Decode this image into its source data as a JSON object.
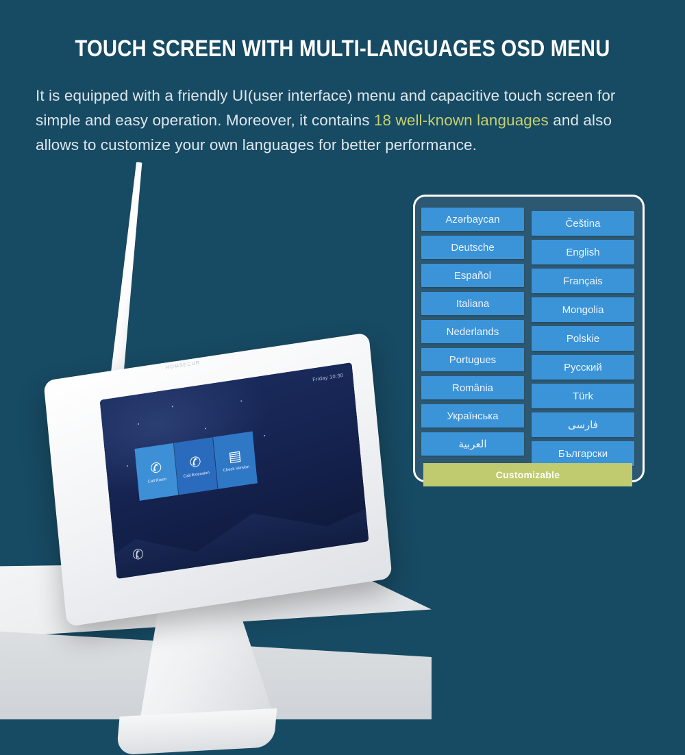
{
  "header": {
    "title": "TOUCH SCREEN WITH MULTI-LANGUAGES OSD MENU",
    "body_part1": "It is equipped with a friendly UI(user interface) menu and capacitive touch screen for simple and easy operation. Moreover, it contains ",
    "body_highlight": "18 well-known languages",
    "body_part2": " and also allows to customize your own languages for better performance."
  },
  "colors": {
    "background": "#174a63",
    "panel": "#2d5871",
    "button": "#3b93d8",
    "accent": "#bfcb6e",
    "frame": "#ffffff"
  },
  "languages": {
    "left_column": [
      "Azərbaycan",
      "Deutsche",
      "Español",
      "Italiana",
      "Nederlands",
      "Portugues",
      "România",
      "Українська",
      "العربية"
    ],
    "right_column": [
      "Čeština",
      "English",
      "Français",
      "Mongolia",
      "Polskie",
      "Русский",
      "Türk",
      "فارسی",
      "Български"
    ],
    "customizable_label": "Customizable"
  },
  "device": {
    "brand": "HOMSECUR",
    "screen": {
      "status_text": "Friday 10:30",
      "tiles": [
        {
          "icon": "phone-ringing-icon",
          "glyph": "✆",
          "label": "Call Room"
        },
        {
          "icon": "phone-handset-icon",
          "glyph": "✆",
          "label": "Call Extension"
        },
        {
          "icon": "door-lock-icon",
          "glyph": "▤",
          "label": "Check Version"
        }
      ],
      "footer_icon": "phone-handset-icon",
      "footer_glyph": "✆"
    }
  }
}
